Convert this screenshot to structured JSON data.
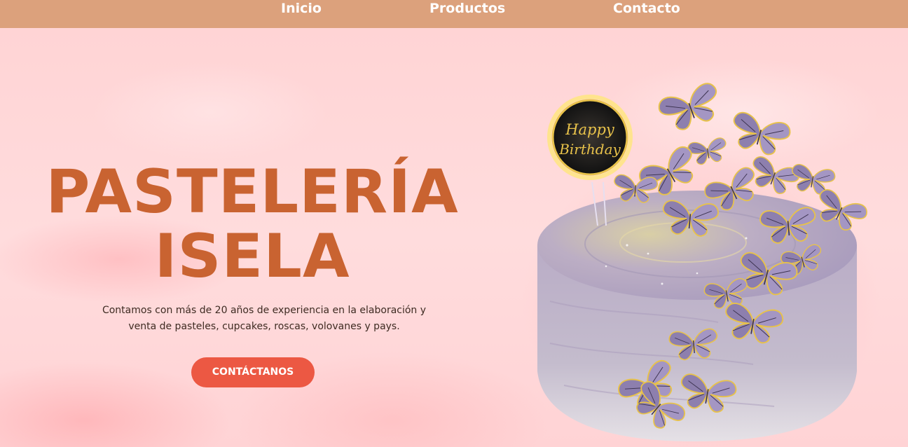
{
  "nav": {
    "items": [
      {
        "label": "Inicio"
      },
      {
        "label": "Productos"
      },
      {
        "label": "Contacto"
      }
    ]
  },
  "hero": {
    "title_line1": "PASTELERÍA",
    "title_line2": "ISELA",
    "description_line1": "Contamos con más de 20 años de experiencia en la elaboración y",
    "description_line2": "venta de pasteles, cupcakes, roscas, volovanes y pays.",
    "cta_label": "CONTÁCTANOS"
  },
  "cake": {
    "topper_line1": "Happy",
    "topper_line2": "Birthday"
  },
  "colors": {
    "navbar": "#dca17c",
    "background": "#ffd9da",
    "title": "#c96331",
    "cta": "#ec5843",
    "cake_frosting": "#b7aac0",
    "butterfly": "#8d7fae",
    "gold": "#e8c24a"
  },
  "icons": {
    "cake_decor": "butterfly-icon"
  }
}
